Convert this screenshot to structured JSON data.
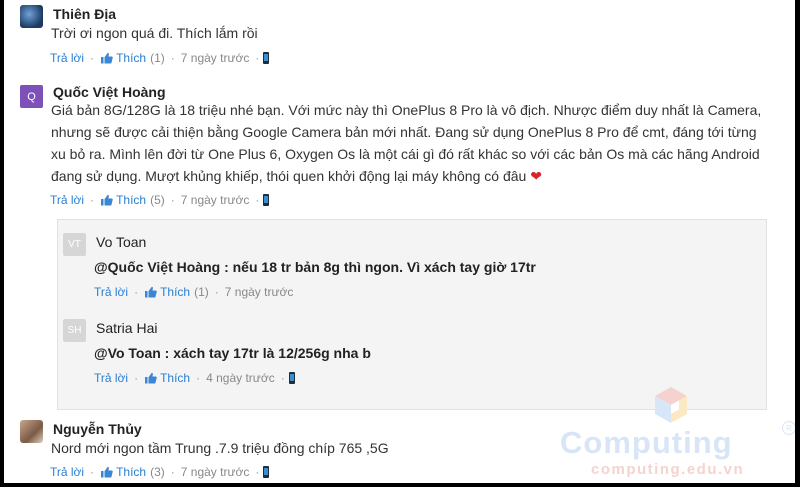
{
  "comments": [
    {
      "author": "Thiên Địa",
      "text": "Trời ơi ngon quá đi. Thích lắm rồi",
      "reply_label": "Trả lời",
      "like_label": "Thích",
      "like_count": "(1)",
      "time": "7 ngày trước"
    },
    {
      "author": "Quốc Việt Hoàng",
      "avatar_letter": "Q",
      "lines": [
        "Giá bản 8G/128G là 18 triệu nhé bạn. Với mức này thì OnePlus 8 Pro là vô địch. Nhược điểm duy nhất là Camera,",
        "nhưng sẽ được cải thiện bằng Google Camera bản mới nhất. Đang sử dụng OnePlus 8 Pro để cmt, đáng tới từng",
        "xu bỏ ra. Mình lên đời từ One Plus 6, Oxygen Os là một cái gì đó rất khác so với các bản Os mà các hãng Android",
        "đang sử dụng. Mượt khủng khiếp, thói quen khởi động lại máy không có đâu"
      ],
      "reply_label": "Trả lời",
      "like_label": "Thích",
      "like_count": "(5)",
      "time": "7 ngày trước",
      "replies": [
        {
          "author": "Vo Toan",
          "avatar_letters": "VT",
          "text": "@Quốc Việt Hoàng : nếu 18 tr bản 8g thì ngon. Vì xách tay giờ 17tr",
          "reply_label": "Trả lời",
          "like_label": "Thích",
          "like_count": "(1)",
          "time": "7 ngày trước"
        },
        {
          "author": "Satria Hai",
          "avatar_letters": "SH",
          "text": "@Vo Toan : xách tay 17tr là 12/256g nha b",
          "reply_label": "Trả lời",
          "like_label": "Thích",
          "like_count": "",
          "time": "4 ngày trước"
        }
      ]
    },
    {
      "author": "Nguyễn Thủy",
      "text": "Nord mới ngon tầm Trung .7.9 triệu đồng chíp 765 ,5G",
      "reply_label": "Trả lời",
      "like_label": "Thích",
      "like_count": "(3)",
      "time": "7 ngày trước"
    }
  ],
  "watermark": {
    "brand": "Computing",
    "site": "computing.edu.vn"
  },
  "colors": {
    "link": "#2a7fd4",
    "avatar_q": "#7c52b8",
    "avatar_reply": "#d6d6d6",
    "heart": "#d9232d"
  },
  "icons": [
    "thumbs-up-icon",
    "mobile-device-icon",
    "heart-icon"
  ]
}
